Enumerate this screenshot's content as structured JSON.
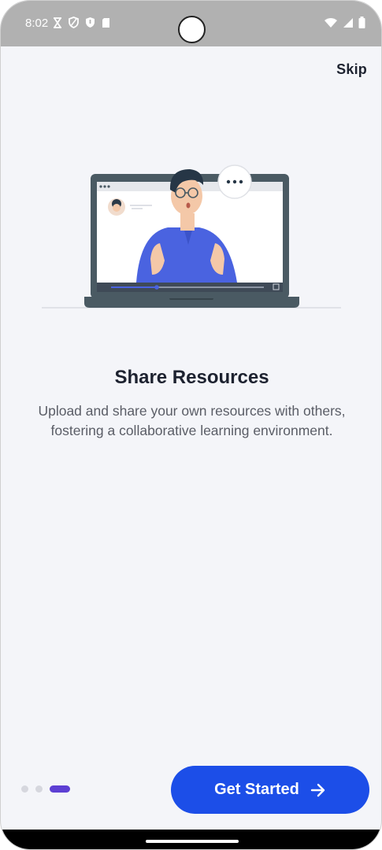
{
  "status_bar": {
    "time": "8:02",
    "left_icons": [
      "hourglass-icon",
      "shield-outline-icon",
      "shield-filled-icon",
      "sim-card-icon"
    ],
    "right_icons": [
      "wifi-icon",
      "signal-icon",
      "battery-icon"
    ]
  },
  "header": {
    "skip_label": "Skip"
  },
  "slide": {
    "illustration": "man-on-laptop-video-call-illustration",
    "title": "Share Resources",
    "description": "Upload and share your own resources with others, fostering a collaborative learning environment."
  },
  "pager": {
    "total": 3,
    "active_index": 2
  },
  "footer": {
    "cta_label": "Get Started",
    "cta_icon": "arrow-right-icon"
  },
  "colors": {
    "background": "#f4f5f9",
    "primary_button": "#1c4ee8",
    "active_dot": "#5d3fd3",
    "title_text": "#1d2230",
    "body_text": "#5a5d66"
  }
}
